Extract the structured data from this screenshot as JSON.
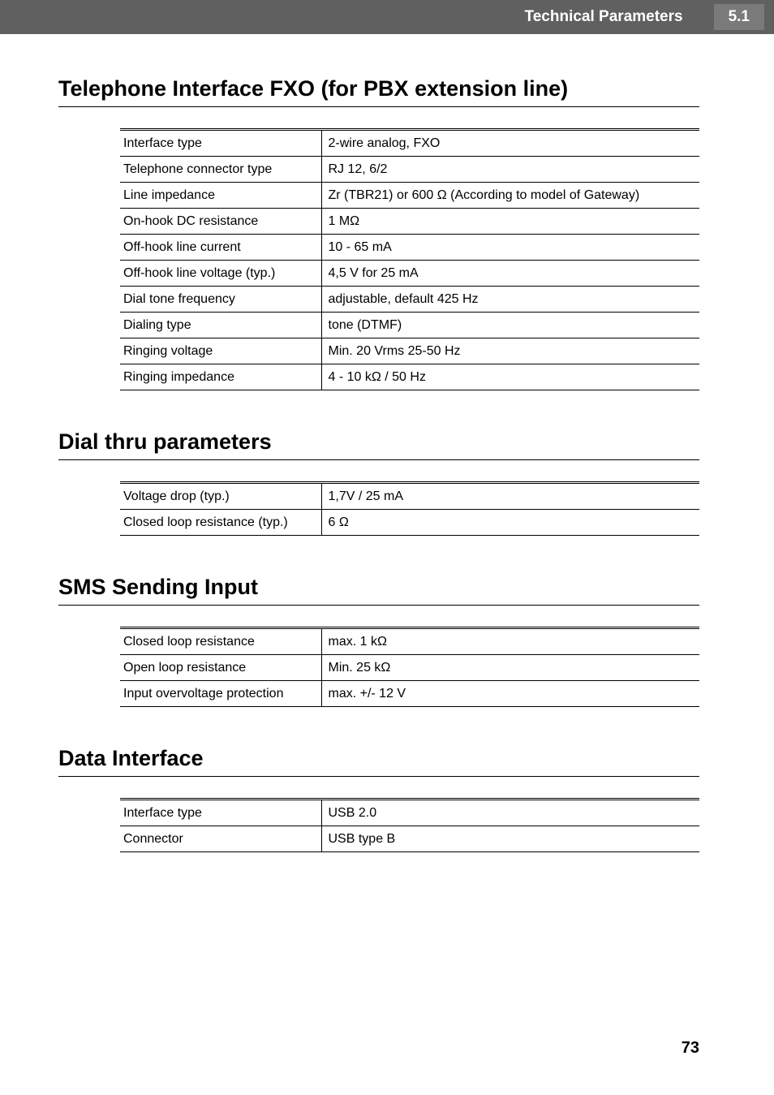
{
  "header": {
    "title": "Technical Parameters",
    "section_number": "5.1"
  },
  "sections": [
    {
      "heading": "Telephone Interface FXO (for PBX extension line)",
      "rows": [
        {
          "label": "Interface type",
          "value": "2-wire analog, FXO"
        },
        {
          "label": "Telephone connector type",
          "value": "RJ 12, 6/2"
        },
        {
          "label": "Line impedance",
          "value": "Zr (TBR21) or 600 Ω (According to model of Gateway)"
        },
        {
          "label": "On-hook DC resistance",
          "value": "1 MΩ"
        },
        {
          "label": "Off-hook line current",
          "value": "10 - 65 mA"
        },
        {
          "label": "Off-hook line voltage (typ.)",
          "value": "4,5 V for 25 mA"
        },
        {
          "label": "Dial tone frequency",
          "value": "adjustable, default 425 Hz"
        },
        {
          "label": "Dialing type",
          "value": "tone (DTMF)"
        },
        {
          "label": "Ringing voltage",
          "value": "Min. 20 Vrms 25-50 Hz"
        },
        {
          "label": "Ringing impedance",
          "value": "4 - 10 kΩ / 50 Hz"
        }
      ]
    },
    {
      "heading": "Dial thru parameters",
      "rows": [
        {
          "label": "Voltage drop (typ.)",
          "value": "1,7V / 25 mA"
        },
        {
          "label": "Closed loop resistance (typ.)",
          "value": "6 Ω"
        }
      ]
    },
    {
      "heading": "SMS Sending Input",
      "rows": [
        {
          "label": "Closed loop resistance",
          "value": "max. 1 kΩ"
        },
        {
          "label": "Open loop resistance",
          "value": "Min. 25 kΩ"
        },
        {
          "label": "Input overvoltage protection",
          "value": "max. +/- 12 V"
        }
      ]
    },
    {
      "heading": "Data Interface",
      "rows": [
        {
          "label": "Interface type",
          "value": "USB 2.0"
        },
        {
          "label": "Connector",
          "value": "USB type B"
        }
      ]
    }
  ],
  "page_number": "73"
}
